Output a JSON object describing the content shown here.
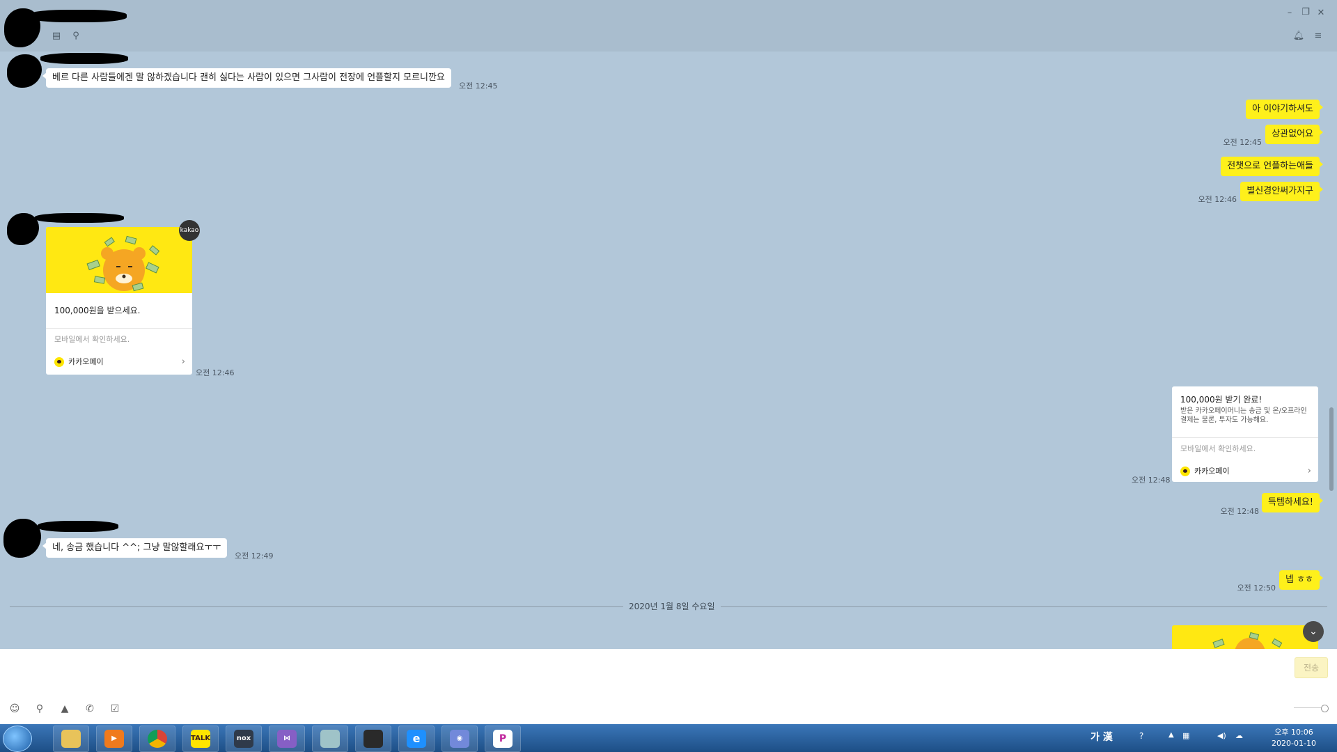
{
  "window": {
    "minimize": "–",
    "restore": "❐",
    "close": "✕"
  },
  "messages": {
    "m1": {
      "text": "베르 다른 사람들에겐  말 않하겠습니다 괜히 싫다는 사람이 있으면 그사람이  전장에 언플할지 모르니깐요",
      "time": "오전 12:45"
    },
    "m2": {
      "text": "아 이야기하셔도"
    },
    "m3": {
      "text": "상관없어요",
      "time": "오전 12:45"
    },
    "m4": {
      "text": "전챗으로 언플하는애들"
    },
    "m5": {
      "text": "별신경안써가지구",
      "time": "오전 12:46"
    },
    "m6": {
      "badge": "kakao",
      "title": "100,000원을 받으세요.",
      "note": "모바일에서 확인하세요.",
      "service": "카카오페이",
      "time": "오전 12:46"
    },
    "m7": {
      "title": "100,000원 받기 완료!",
      "body": "받은 카카오페이머니는 송금 및 온/오프라인 결제는 물론, 투자도 가능해요.",
      "note": "모바일에서 확인하세요.",
      "service": "카카오페이",
      "time": "오전 12:48"
    },
    "m8": {
      "text": "득템하세요!",
      "time": "오전 12:48"
    },
    "m9": {
      "text": "네,  송금 했습니다    ^^;   그냥 말않할래요ㅜㅜ",
      "time": "오전 12:49"
    },
    "m10": {
      "text": "넵 ㅎㅎ",
      "time": "오전 12:50"
    }
  },
  "date_separator": "2020년 1월 8일 수요일",
  "input": {
    "placeholder": "",
    "send_label": "전송"
  },
  "taskbar": {
    "apps": [
      "explorer",
      "media-player",
      "chrome",
      "kakaotalk",
      "nox",
      "visual-studio",
      "notes",
      "game",
      "internet-explorer",
      "discord",
      "paint"
    ],
    "kakaotalk_label": "TALK",
    "nox_label": "nox",
    "ime": "가 漢",
    "time": "오후 10:06",
    "date": "2020-01-10"
  },
  "colors": {
    "chat_bg": "#b2c7d9",
    "bubble_out": "#fef01b",
    "bubble_in": "#ffffff",
    "kakao_yellow": "#fee500"
  }
}
